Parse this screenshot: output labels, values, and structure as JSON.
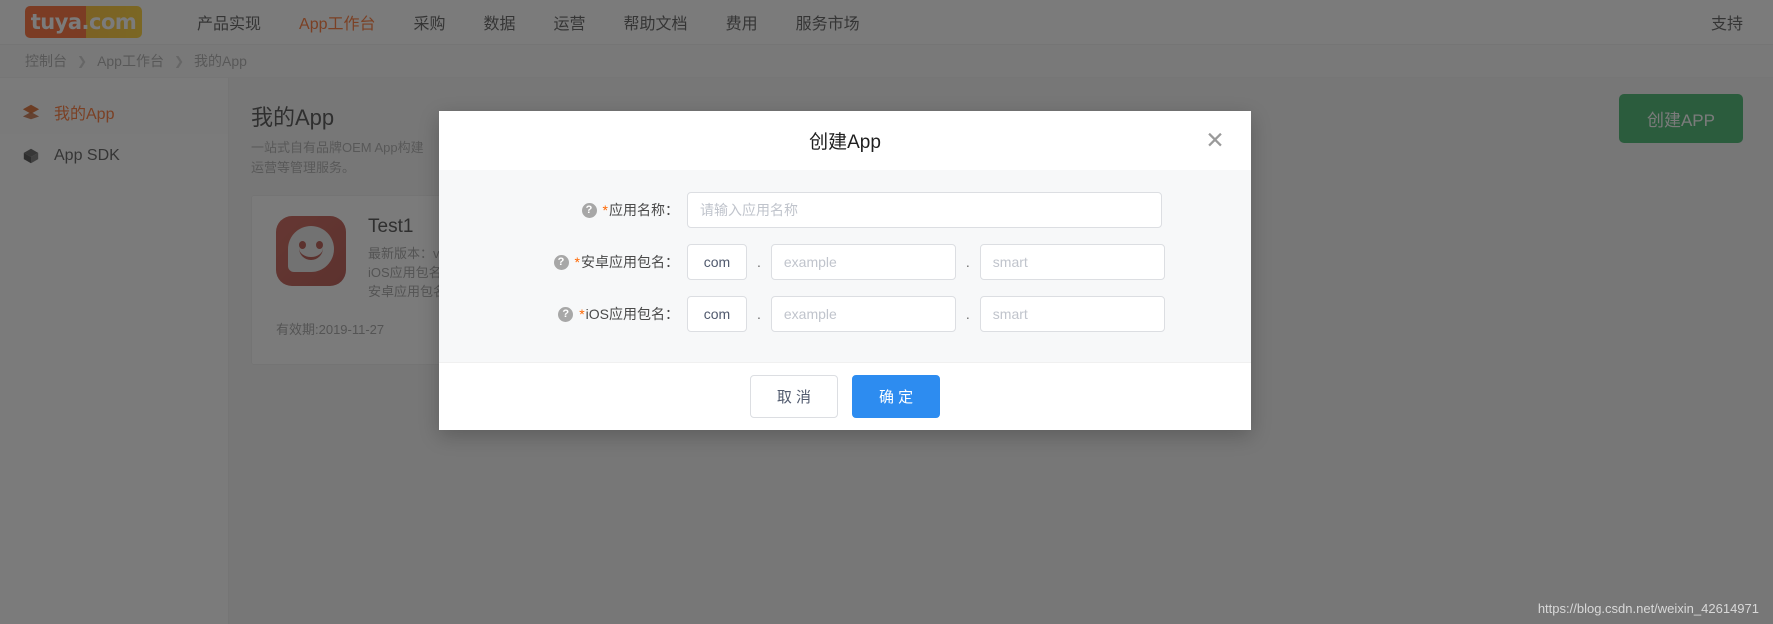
{
  "header": {
    "logo_text": "tuya.com",
    "logo_colors": {
      "left": "#ff4800",
      "right": "#ffc400"
    },
    "nav_items": [
      {
        "label": "产品实现",
        "active": false
      },
      {
        "label": "App工作台",
        "active": true
      },
      {
        "label": "采购",
        "active": false
      },
      {
        "label": "数据",
        "active": false
      },
      {
        "label": "运营",
        "active": false
      },
      {
        "label": "帮助文档",
        "active": false
      },
      {
        "label": "费用",
        "active": false
      },
      {
        "label": "服务市场",
        "active": false
      }
    ],
    "support_label": "支持",
    "active_color": "#ff5400"
  },
  "breadcrumb": {
    "items": [
      "控制台",
      "App工作台",
      "我的App"
    ],
    "separator": "❯"
  },
  "sidebar": {
    "items": [
      {
        "label": "我的App",
        "icon": "layers-icon",
        "active": true
      },
      {
        "label": "App SDK",
        "icon": "cube-icon",
        "active": false
      }
    ]
  },
  "main": {
    "title": "我的App",
    "subtitle_line1": "一站式自有品牌OEM App构建",
    "subtitle_line2": "运营等管理服务。",
    "create_button": "创建APP",
    "create_button_color": "#16a34a",
    "app_card": {
      "name": "Test1",
      "version_line": "最新版本：v",
      "ios_line": "iOS应用包名",
      "android_line": "安卓应用包名",
      "expire": "有效期:2019-11-27"
    }
  },
  "modal": {
    "title": "创建App",
    "close_icon": "✕",
    "help_icon": "?",
    "required_mark": "*",
    "dot_separator": ".",
    "fields": [
      {
        "label": "应用名称",
        "type": "single",
        "placeholder": "请输入应用名称",
        "value": ""
      },
      {
        "label": "安卓应用包名",
        "type": "package",
        "prefix_value": "com",
        "mid_placeholder": "example",
        "mid_value": "",
        "end_placeholder": "smart",
        "end_value": ""
      },
      {
        "label": "iOS应用包名",
        "type": "package",
        "prefix_value": "com",
        "mid_placeholder": "example",
        "mid_value": "",
        "end_placeholder": "smart",
        "end_value": ""
      }
    ],
    "cancel_label": "取 消",
    "confirm_label": "确 定",
    "confirm_color": "#2d8cf0"
  },
  "watermark": "https://blog.csdn.net/weixin_42614971"
}
